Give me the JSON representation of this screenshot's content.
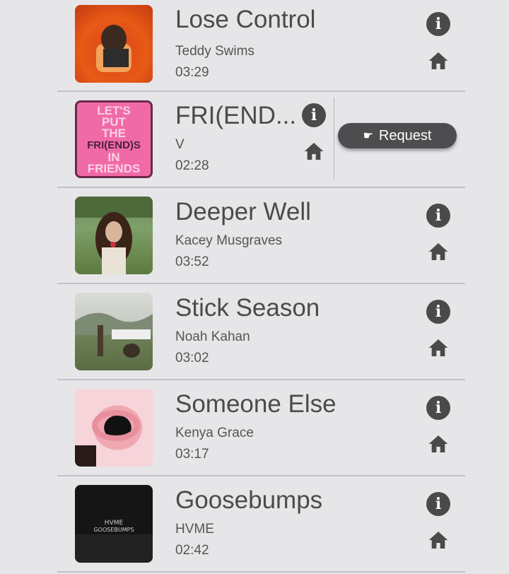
{
  "request_label": "Request",
  "songs": [
    {
      "title": "Lose Control",
      "artist": "Teddy Swims",
      "duration": "03:29"
    },
    {
      "title": "FRI(END...",
      "artist": "V",
      "duration": "02:28"
    },
    {
      "title": "Deeper Well",
      "artist": "Kacey Musgraves",
      "duration": "03:52"
    },
    {
      "title": "Stick Season",
      "artist": "Noah Kahan",
      "duration": "03:02"
    },
    {
      "title": "Someone Else",
      "artist": "Kenya Grace",
      "duration": "03:17"
    },
    {
      "title": "Goosebumps",
      "artist": "HVME",
      "duration": "02:42"
    }
  ],
  "covers": {
    "friends_lines": [
      "LET'S",
      "PUT",
      "THE",
      "FRI(END)S",
      "IN",
      "FRIENDS"
    ],
    "goosebumps_lines": [
      "HVME",
      "GOOSEBUMPS"
    ]
  }
}
